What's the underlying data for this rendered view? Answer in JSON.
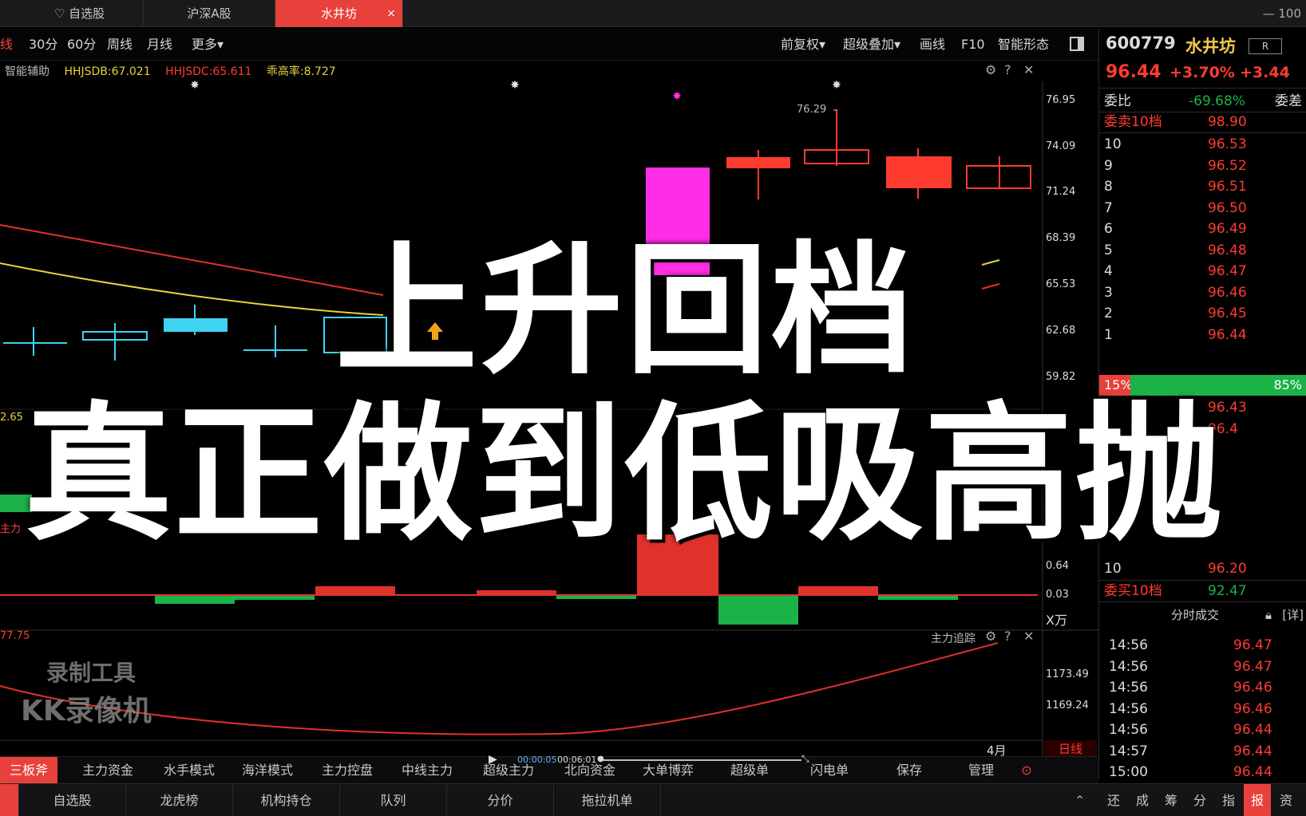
{
  "tabs": [
    {
      "label": "♡ 自选股"
    },
    {
      "label": "沪深A股"
    },
    {
      "label": "水井坊",
      "active": true,
      "close": "×"
    }
  ],
  "window_ctrl": "— 100",
  "toolbar": {
    "left": [
      "线",
      "30分",
      "60分",
      "周线",
      "月线",
      "更多▾"
    ],
    "right": [
      "前复权▾",
      "超级叠加▾",
      "画线",
      "F10",
      "智能形态"
    ]
  },
  "indicator": {
    "label": "智能辅助",
    "hhjsdb": "HHJSDB:67.021",
    "hhjsdc": "HHJSDC:65.611",
    "deviation": "乖高率:8.727"
  },
  "price_axis": [
    "76.95",
    "74.09",
    "71.24",
    "68.39",
    "65.53",
    "62.68",
    "59.82"
  ],
  "peak_label": "76.29",
  "lower_axis": [
    "0.64",
    "0.03"
  ],
  "lower_unit": "X万",
  "left_fragments": {
    "a": "2.65",
    "b": "主力",
    "c": "77.75"
  },
  "tracker": {
    "label": "主力追踪",
    "axis": [
      "1173.49",
      "1169.24"
    ],
    "month": "4月",
    "period": "日线"
  },
  "quote": {
    "code": "600779",
    "name": "水井坊",
    "r_button": "R",
    "price": "96.44",
    "pct": "+3.70%",
    "chg": "+3.44",
    "weibi_label": "委比",
    "weibi_value": "-69.68%",
    "weicha_label": "委差",
    "sell_label": "委卖10档",
    "sell_value": "98.90",
    "sell_levels": [
      {
        "n": "10",
        "p": "96.53"
      },
      {
        "n": "9",
        "p": "96.52"
      },
      {
        "n": "8",
        "p": "96.51"
      },
      {
        "n": "7",
        "p": "96.50"
      },
      {
        "n": "6",
        "p": "96.49"
      },
      {
        "n": "5",
        "p": "96.48"
      },
      {
        "n": "4",
        "p": "96.47"
      },
      {
        "n": "3",
        "p": "96.46"
      },
      {
        "n": "2",
        "p": "96.45"
      },
      {
        "n": "1",
        "p": "96.44"
      }
    ],
    "ratio_left": "15%",
    "ratio_right": "85%",
    "buy_levels": [
      {
        "n": "1",
        "p": "96.43"
      },
      {
        "n": "2",
        "p": "96.4"
      }
    ],
    "buy_last": {
      "n": "10",
      "p": "96.20"
    },
    "buy_label": "委买10档",
    "buy_value": "92.47",
    "ticks_label": "分时成交",
    "ticks_detail": "[详]",
    "ticks": [
      {
        "t": "14:56",
        "p": "96.47"
      },
      {
        "t": "14:56",
        "p": "96.47"
      },
      {
        "t": "14:56",
        "p": "96.46"
      },
      {
        "t": "14:56",
        "p": "96.46"
      },
      {
        "t": "14:56",
        "p": "96.44"
      },
      {
        "t": "14:57",
        "p": "96.44"
      },
      {
        "t": "15:00",
        "p": "96.44"
      }
    ]
  },
  "bottom_tabs": [
    "三板斧",
    "主力资金",
    "水手模式",
    "海洋模式",
    "主力控盘",
    "中线主力",
    "超级主力",
    "北向资金",
    "大单博弈",
    "超级单",
    "闪电单",
    "保存",
    "管理"
  ],
  "bottom_nav": [
    "自选股",
    "龙虎榜",
    "机构持仓",
    "队列",
    "分价",
    "拖拉机单"
  ],
  "right_nav": [
    "还",
    "成",
    "筹",
    "分",
    "指",
    "报",
    "资"
  ],
  "player": {
    "current": "00:00:05",
    "total": "00:06:01"
  },
  "overlay": {
    "line1": "上升回档",
    "line2": "真正做到低吸高抛"
  },
  "watermark": {
    "line1": "录制工具",
    "line2": "KK录像机"
  },
  "colors": {
    "up": "#ff3b30",
    "down": "#1bb247",
    "cyan": "#3fd3f2",
    "magenta": "#ff2ee6",
    "yellow": "#e6d33a"
  }
}
